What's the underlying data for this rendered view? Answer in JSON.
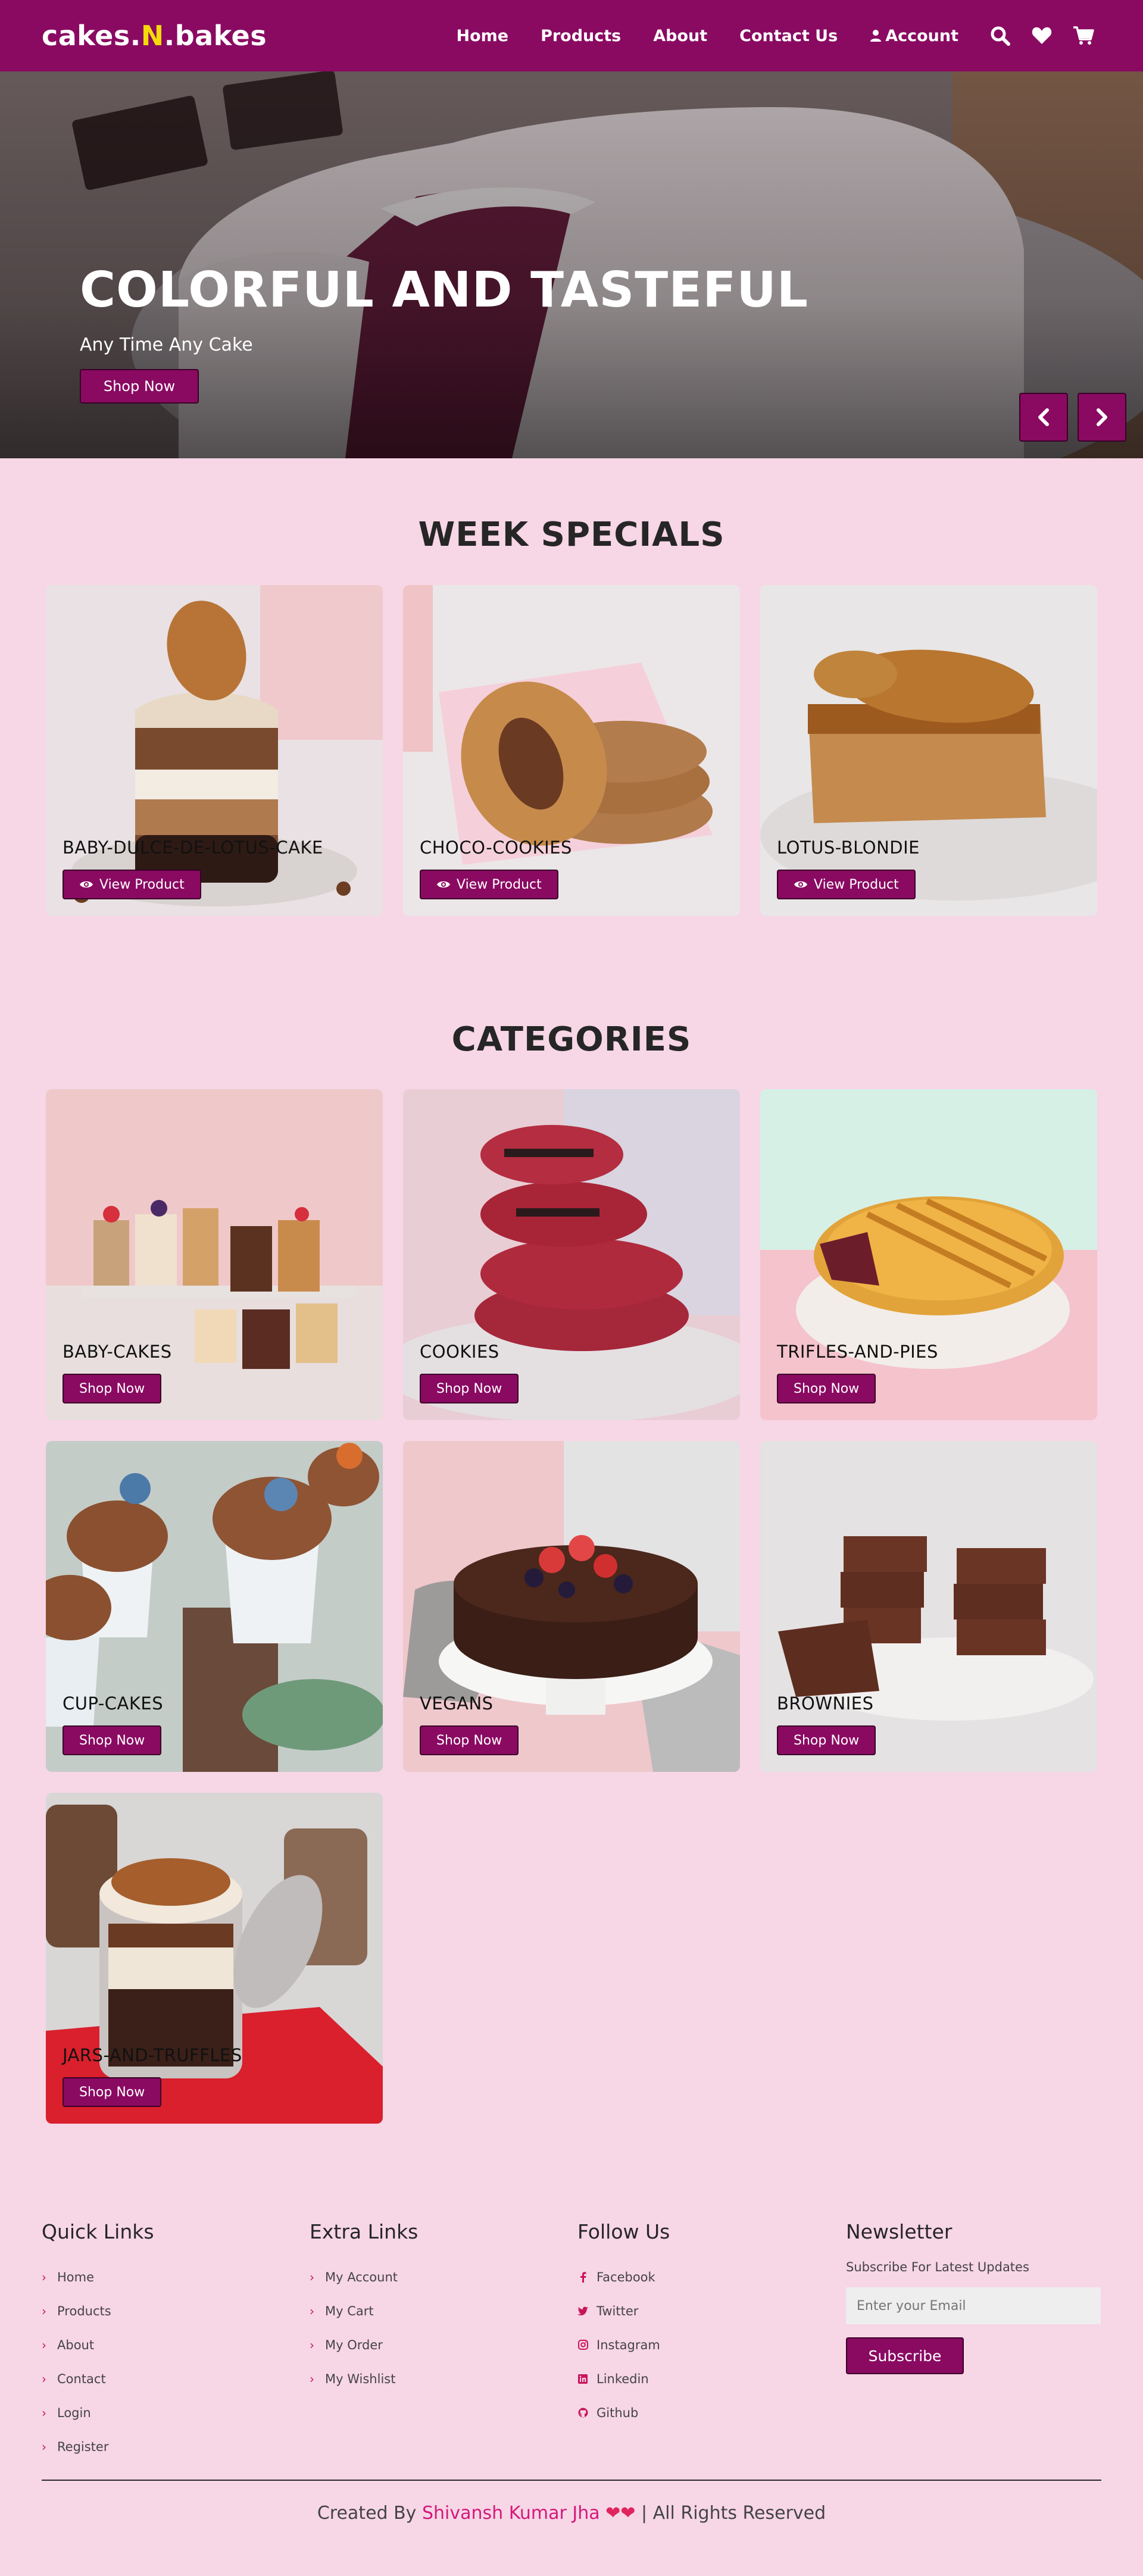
{
  "brand": {
    "part1": "cakes.",
    "part2": "N",
    "part3": ".bakes",
    "accent_color": "#f5d90a",
    "primary_color": "#8a0a62"
  },
  "nav": {
    "links": [
      "Home",
      "Products",
      "About",
      "Contact Us"
    ],
    "account_label": "Account",
    "icons": [
      "search-icon",
      "heart-icon",
      "cart-icon"
    ]
  },
  "hero": {
    "title": "COLORFUL AND TASTEFUL",
    "subtitle": "Any Time Any Cake",
    "button_label": "Shop Now"
  },
  "week_specials": {
    "title": "WEEK SPECIALS",
    "items": [
      {
        "name": "BABY-DULCE-DE-LOTUS-CAKE",
        "button": "View Product"
      },
      {
        "name": "CHOCO-COOKIES",
        "button": "View Product"
      },
      {
        "name": "LOTUS-BLONDIE",
        "button": "View Product"
      }
    ]
  },
  "categories": {
    "title": "CATEGORIES",
    "items": [
      {
        "name": "BABY-CAKES",
        "button": "Shop Now"
      },
      {
        "name": "COOKIES",
        "button": "Shop Now"
      },
      {
        "name": "TRIFLES-AND-PIES",
        "button": "Shop Now"
      },
      {
        "name": "CUP-CAKES",
        "button": "Shop Now"
      },
      {
        "name": "VEGANS",
        "button": "Shop Now"
      },
      {
        "name": "BROWNIES",
        "button": "Shop Now"
      },
      {
        "name": "JARS-AND-TRUFFLES",
        "button": "Shop Now"
      }
    ]
  },
  "footer": {
    "quick_links": {
      "title": "Quick Links",
      "items": [
        "Home",
        "Products",
        "About",
        "Contact",
        "Login",
        "Register"
      ]
    },
    "extra_links": {
      "title": "Extra Links",
      "items": [
        "My Account",
        "My Cart",
        "My Order",
        "My Wishlist"
      ]
    },
    "follow_us": {
      "title": "Follow Us",
      "items": [
        "Facebook",
        "Twitter",
        "Instagram",
        "Linkedin",
        "Github"
      ]
    },
    "newsletter": {
      "title": "Newsletter",
      "text": "Subscribe For Latest Updates",
      "placeholder": "Enter your Email",
      "button": "Subscribe"
    },
    "copyright": {
      "prefix": "Created By ",
      "author": "Shivansh Kumar Jha",
      "hearts": "❤❤",
      "suffix": " | All Rights Reserved"
    }
  }
}
